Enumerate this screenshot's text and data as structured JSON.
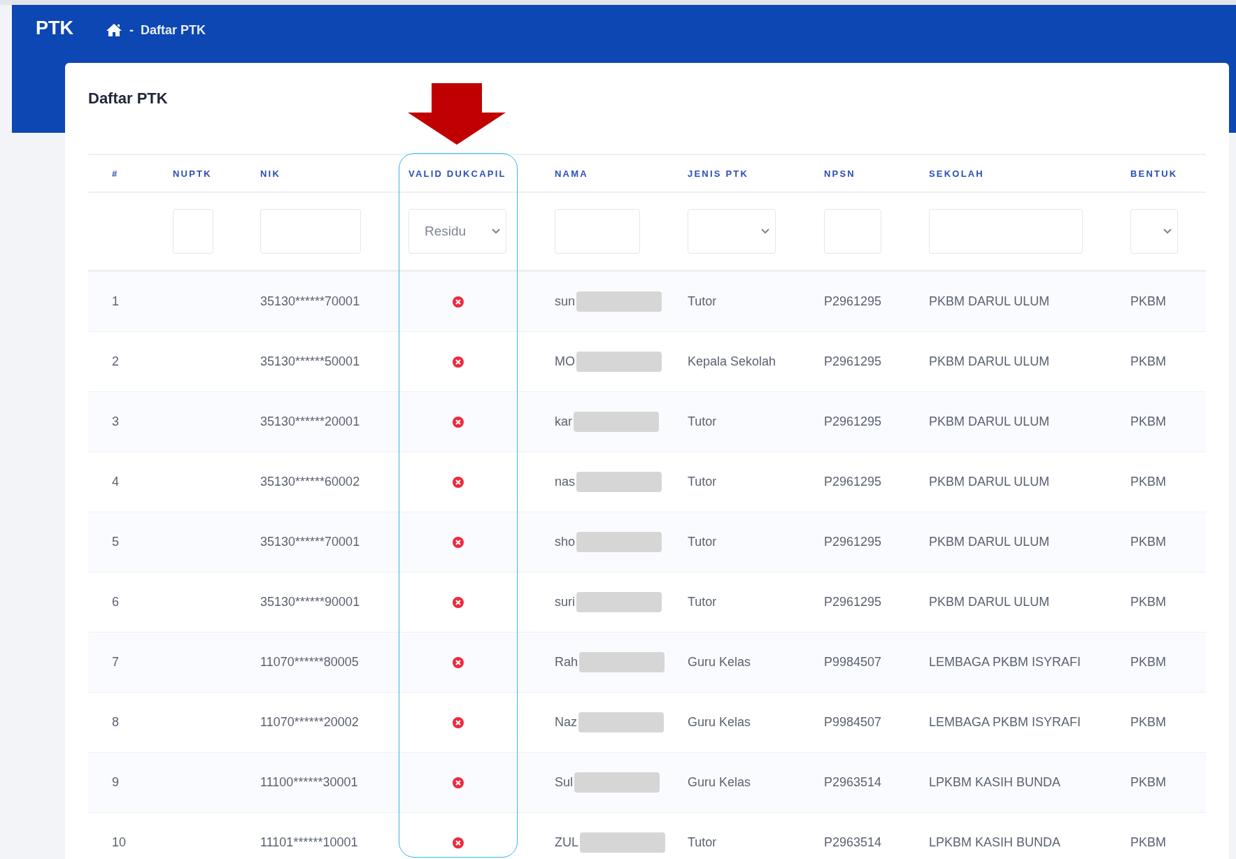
{
  "app": {
    "title": "PTK"
  },
  "breadcrumb": {
    "separator": "-",
    "current": "Daftar PTK"
  },
  "card": {
    "title": "Daftar PTK"
  },
  "table": {
    "columns": [
      {
        "label": "#",
        "highlighted": false
      },
      {
        "label": "NUPTK",
        "highlighted": false
      },
      {
        "label": "NIK",
        "highlighted": false
      },
      {
        "label": "VALID DUKCAPIL",
        "highlighted": true
      },
      {
        "label": "NAMA",
        "highlighted": false
      },
      {
        "label": "JENIS PTK",
        "highlighted": false
      },
      {
        "label": "NPSN",
        "highlighted": false
      },
      {
        "label": "SEKOLAH",
        "highlighted": false
      },
      {
        "label": "BENTUK",
        "highlighted": false
      }
    ],
    "filters": [
      {
        "kind": "none"
      },
      {
        "kind": "input"
      },
      {
        "kind": "input"
      },
      {
        "kind": "select",
        "value": "Residu"
      },
      {
        "kind": "input"
      },
      {
        "kind": "select"
      },
      {
        "kind": "input"
      },
      {
        "kind": "input"
      },
      {
        "kind": "select"
      }
    ],
    "rows": [
      {
        "number": "1",
        "nik": "35130******70001",
        "valid": false,
        "nama": "sun",
        "redacted": true,
        "jenis_ptk": "Tutor",
        "npsn": "P2961295",
        "sekolah": "PKBM DARUL ULUM",
        "bentuk": "PKBM"
      },
      {
        "number": "2",
        "nik": "35130******50001",
        "valid": false,
        "nama": "MO",
        "redacted": true,
        "jenis_ptk": "Kepala Sekolah",
        "npsn": "P2961295",
        "sekolah": "PKBM DARUL ULUM",
        "bentuk": "PKBM"
      },
      {
        "number": "3",
        "nik": "35130******20001",
        "valid": false,
        "nama": "kar",
        "redacted": true,
        "jenis_ptk": "Tutor",
        "npsn": "P2961295",
        "sekolah": "PKBM DARUL ULUM",
        "bentuk": "PKBM"
      },
      {
        "number": "4",
        "nik": "35130******60002",
        "valid": false,
        "nama": "nas",
        "redacted": true,
        "jenis_ptk": "Tutor",
        "npsn": "P2961295",
        "sekolah": "PKBM DARUL ULUM",
        "bentuk": "PKBM"
      },
      {
        "number": "5",
        "nik": "35130******70001",
        "valid": false,
        "nama": "sho",
        "redacted": true,
        "jenis_ptk": "Tutor",
        "npsn": "P2961295",
        "sekolah": "PKBM DARUL ULUM",
        "bentuk": "PKBM"
      },
      {
        "number": "6",
        "nik": "35130******90001",
        "valid": false,
        "nama": "suri",
        "redacted": true,
        "jenis_ptk": "Tutor",
        "npsn": "P2961295",
        "sekolah": "PKBM DARUL ULUM",
        "bentuk": "PKBM"
      },
      {
        "number": "7",
        "nik": "11070******80005",
        "valid": false,
        "nama": "Rah",
        "redacted": true,
        "jenis_ptk": "Guru Kelas",
        "npsn": "P9984507",
        "sekolah": "LEMBAGA PKBM ISYRAFI",
        "bentuk": "PKBM"
      },
      {
        "number": "8",
        "nik": "11070******20002",
        "valid": false,
        "nama": "Naz",
        "redacted": true,
        "jenis_ptk": "Guru Kelas",
        "npsn": "P9984507",
        "sekolah": "LEMBAGA PKBM ISYRAFI",
        "bentuk": "PKBM"
      },
      {
        "number": "9",
        "nik": "11100******30001",
        "valid": false,
        "nama": "Sul",
        "redacted": true,
        "jenis_ptk": "Guru Kelas",
        "npsn": "P2963514",
        "sekolah": "LPKBM KASIH BUNDA",
        "bentuk": "PKBM"
      },
      {
        "number": "10",
        "nik": "11101******10001",
        "valid": false,
        "nama": "ZUL",
        "redacted": true,
        "jenis_ptk": "Tutor",
        "npsn": "P2963514",
        "sekolah": "LPKBM KASIH BUNDA",
        "bentuk": "PKBM"
      }
    ]
  },
  "annotations": {
    "arrow": true
  }
}
